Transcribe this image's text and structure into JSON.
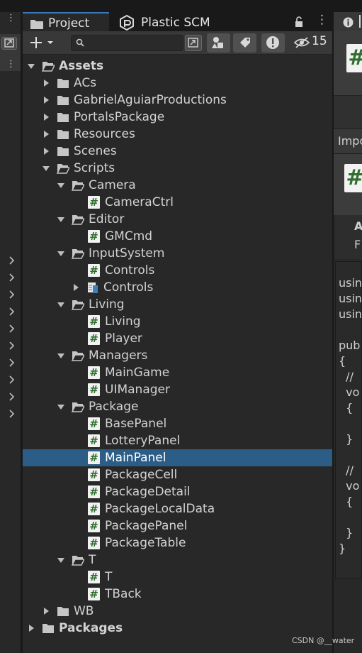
{
  "tabs": {
    "project": "Project",
    "plastic": "Plastic SCM"
  },
  "toolbar": {
    "hidden_count": "15",
    "search_placeholder": ""
  },
  "tree": [
    {
      "label": "Assets",
      "depth": 0,
      "type": "folder",
      "open": true,
      "bold": true
    },
    {
      "label": "ACs",
      "depth": 1,
      "type": "folder",
      "open": false
    },
    {
      "label": "GabrielAguiarProductions",
      "depth": 1,
      "type": "folder",
      "open": false
    },
    {
      "label": "PortalsPackage",
      "depth": 1,
      "type": "folder",
      "open": false
    },
    {
      "label": "Resources",
      "depth": 1,
      "type": "folder",
      "open": false
    },
    {
      "label": "Scenes",
      "depth": 1,
      "type": "folder",
      "open": false
    },
    {
      "label": "Scripts",
      "depth": 1,
      "type": "folder",
      "open": true
    },
    {
      "label": "Camera",
      "depth": 2,
      "type": "folder",
      "open": true
    },
    {
      "label": "CameraCtrl",
      "depth": 3,
      "type": "script"
    },
    {
      "label": "Editor",
      "depth": 2,
      "type": "folder",
      "open": true
    },
    {
      "label": "GMCmd",
      "depth": 3,
      "type": "script"
    },
    {
      "label": "InputSystem",
      "depth": 2,
      "type": "folder",
      "open": true
    },
    {
      "label": "Controls",
      "depth": 3,
      "type": "script"
    },
    {
      "label": "Controls",
      "depth": 3,
      "type": "asset",
      "open": false
    },
    {
      "label": "Living",
      "depth": 2,
      "type": "folder",
      "open": true
    },
    {
      "label": "Living",
      "depth": 3,
      "type": "script"
    },
    {
      "label": "Player",
      "depth": 3,
      "type": "script"
    },
    {
      "label": "Managers",
      "depth": 2,
      "type": "folder",
      "open": true
    },
    {
      "label": "MainGame",
      "depth": 3,
      "type": "script"
    },
    {
      "label": "UIManager",
      "depth": 3,
      "type": "script"
    },
    {
      "label": "Package",
      "depth": 2,
      "type": "folder",
      "open": true
    },
    {
      "label": "BasePanel",
      "depth": 3,
      "type": "script"
    },
    {
      "label": "LotteryPanel",
      "depth": 3,
      "type": "script"
    },
    {
      "label": "MainPanel",
      "depth": 3,
      "type": "script",
      "selected": true
    },
    {
      "label": "PackageCell",
      "depth": 3,
      "type": "script"
    },
    {
      "label": "PackageDetail",
      "depth": 3,
      "type": "script"
    },
    {
      "label": "PackageLocalData",
      "depth": 3,
      "type": "script"
    },
    {
      "label": "PackagePanel",
      "depth": 3,
      "type": "script"
    },
    {
      "label": "PackageTable",
      "depth": 3,
      "type": "script"
    },
    {
      "label": "T",
      "depth": 2,
      "type": "folder",
      "open": true
    },
    {
      "label": "T",
      "depth": 3,
      "type": "script"
    },
    {
      "label": "TBack",
      "depth": 3,
      "type": "script"
    },
    {
      "label": "WB",
      "depth": 1,
      "type": "folder",
      "open": false
    },
    {
      "label": "Packages",
      "depth": 0,
      "type": "folder",
      "open": false,
      "bold": true
    }
  ],
  "inspector": {
    "impo_label": "Impo",
    "header_a": "A",
    "header_f": "F",
    "code_lines": [
      "usin",
      "usin",
      "usin",
      "",
      "publ",
      "{",
      "  //",
      "  vo",
      "  {",
      "",
      "  }",
      "",
      "  //",
      "  vo",
      "  {",
      "",
      "  }",
      "}"
    ]
  },
  "watermark": "CSDN @__water",
  "colors": {
    "background": "#191919",
    "panel": "#282828",
    "selection": "#2c5d87",
    "tab_accent": "#3a79bb",
    "script_icon_hash": "#2f6e2f"
  }
}
